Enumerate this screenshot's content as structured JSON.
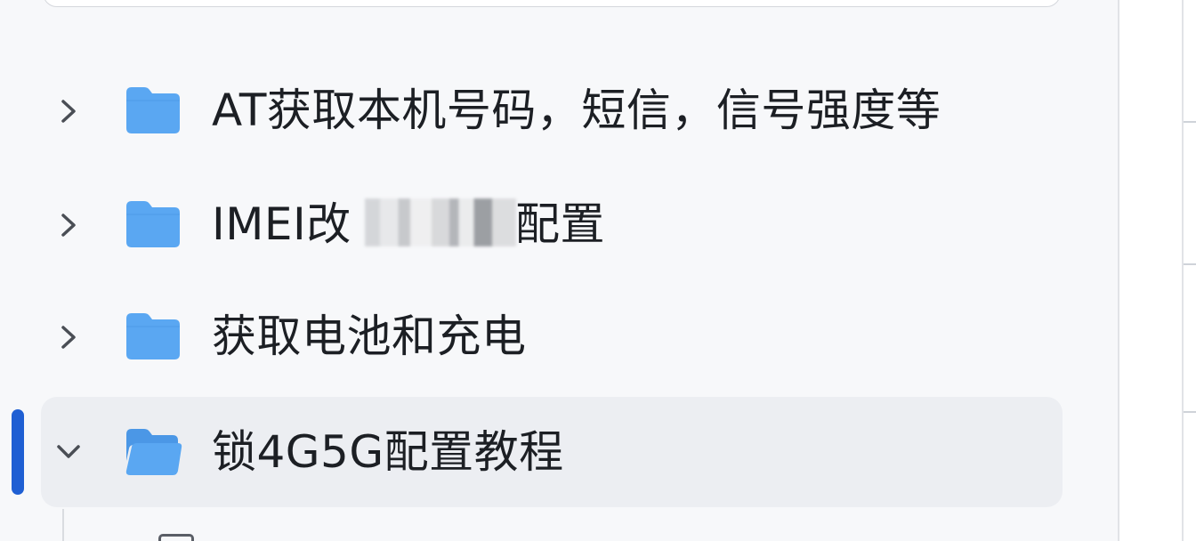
{
  "tree": {
    "items": [
      {
        "label": "AT获取本机号码，短信，信号强度等",
        "icon": "folder-icon",
        "expanded": false
      },
      {
        "label_prefix": "IMEI改",
        "label_suffix": "配置",
        "icon": "folder-icon",
        "expanded": false,
        "redacted": true
      },
      {
        "label": "获取电池和充电",
        "icon": "folder-icon",
        "expanded": false
      },
      {
        "label": "锁4G5G配置教程",
        "icon": "folder-open-icon",
        "expanded": true,
        "selected": true
      }
    ]
  },
  "colors": {
    "folder": "#5aa7f2",
    "folder_dark": "#4b97e6",
    "accent": "#1f5fd3",
    "text": "#1c1f24",
    "selected_bg": "#eceef2"
  }
}
